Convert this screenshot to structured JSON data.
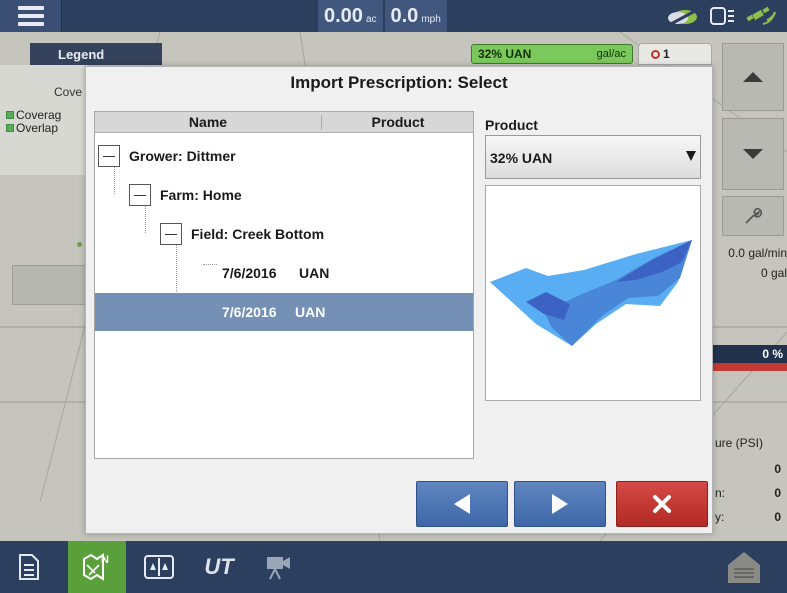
{
  "topbar": {
    "area_value": "0.00",
    "area_unit": "ac",
    "speed_value": "0.0",
    "speed_unit": "mph"
  },
  "map": {
    "legend_title": "Legend",
    "legend_coverage_heading": "Cove",
    "legend_entries": [
      {
        "label": "Coverag",
        "color": "#5aa95d"
      },
      {
        "label": "Overlap",
        "color": "#5aa95d"
      }
    ],
    "product_chip": {
      "name": "32% UAN",
      "unit": "gal/ac"
    },
    "alert_count": "1",
    "rate_line1": "0.0 gal/min",
    "rate_line2": "0 gal",
    "percent": "0 %",
    "pressure_label": "ure (PSI)",
    "pressure_rows": [
      {
        "label": "",
        "value": "0"
      },
      {
        "label": "n:",
        "value": "0"
      },
      {
        "label": "y:",
        "value": "0"
      }
    ]
  },
  "dialog": {
    "title": "Import Prescription: Select",
    "columns": {
      "name": "Name",
      "product": "Product"
    },
    "tree": {
      "grower": "Grower: Dittmer",
      "farm": "Farm: Home",
      "field": "Field: Creek Bottom",
      "prescriptions": [
        {
          "date": "7/6/2016",
          "product": "UAN",
          "selected": false
        },
        {
          "date": "7/6/2016",
          "product": "UAN",
          "selected": true
        }
      ]
    },
    "product_label": "Product",
    "product_selected": "32% UAN",
    "preview_colors": {
      "light": "#59adf2",
      "mid": "#4a86d8",
      "dark": "#3c63c4"
    }
  },
  "bottombar": {
    "ut_label": "UT",
    "active_tab": "prescription",
    "active_color": "#5aa03a"
  },
  "colors": {
    "bar_bg": "#2d3f5f",
    "selection": "#7490b4",
    "nav_button": "#4a74b4",
    "cancel_button": "#c2332e"
  }
}
